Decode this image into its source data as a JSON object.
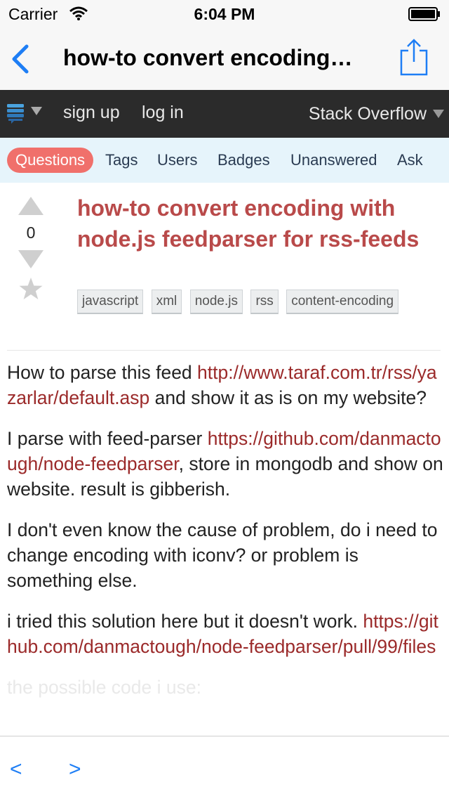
{
  "status_bar": {
    "carrier": "Carrier",
    "time": "6:04 PM"
  },
  "nav_bar": {
    "title": "how-to convert encoding…"
  },
  "site_header": {
    "sign_up": "sign up",
    "log_in": "log in",
    "site_name": "Stack Overflow"
  },
  "tabs": [
    {
      "label": "Questions",
      "active": true
    },
    {
      "label": "Tags"
    },
    {
      "label": "Users"
    },
    {
      "label": "Badges"
    },
    {
      "label": "Unanswered"
    },
    {
      "label": "Ask"
    }
  ],
  "question": {
    "votes": "0",
    "title": "how-to convert encoding with node.js feedparser for rss-feeds",
    "tags": [
      "javascript",
      "xml",
      "node.js",
      "rss",
      "content-encoding"
    ],
    "body": {
      "p1_text": "How to parse this feed ",
      "p1_link": "http://www.taraf.com.tr/rss/yazarlar/default.asp",
      "p1_tail": " and show it as is on my website?",
      "p2_text": "I parse with feed-parser ",
      "p2_link": "https://github.com/danmactough/node-feedparser",
      "p2_tail": ", store in mongodb and show on website. result is gibberish.",
      "p3_text": "I don't even know the cause of problem, do i need to change encoding with iconv? or problem is something else.",
      "p4_text": "i tried this solution here but it doesn't work. ",
      "p4_link": "https://github.com/danmactough/node-feedparser/pull/99/files",
      "p5_text": "the possible code i use:"
    }
  },
  "bottom_bar": {
    "prev": "<",
    "next": ">"
  },
  "colors": {
    "accent_blue": "#1e7ef5",
    "link_red": "#9b2a2a",
    "title_red": "#b94a4a",
    "active_tab": "#f0706b",
    "tab_bg": "#e6f4fb",
    "header_bg": "#2b2b2b"
  }
}
